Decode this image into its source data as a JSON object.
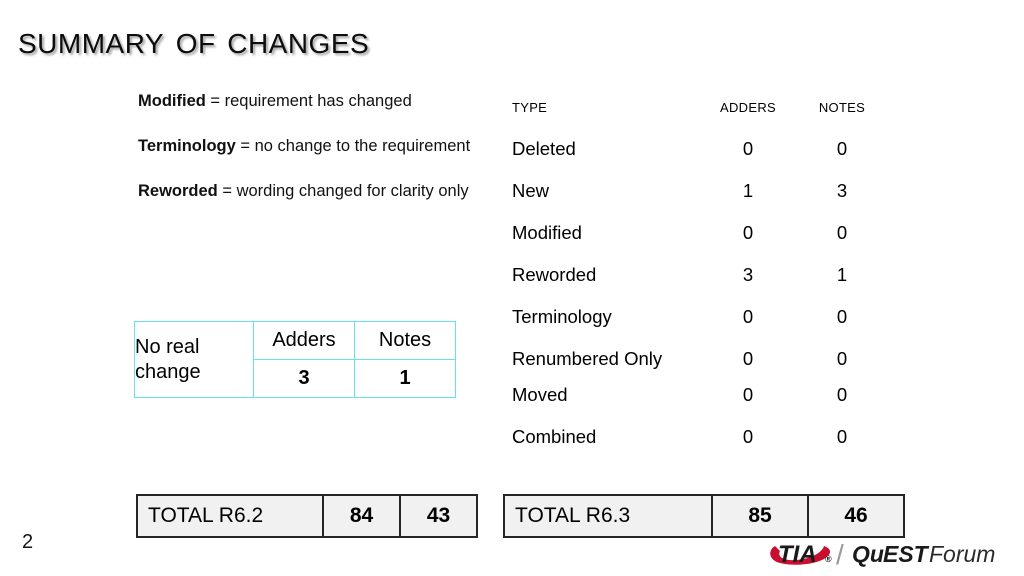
{
  "slide": {
    "title": "Summary of Changes",
    "page_number": "2"
  },
  "definitions": [
    {
      "term": "Modified",
      "rest": " = requirement has changed"
    },
    {
      "term": "Terminology",
      "rest": " = no change to the requirement"
    },
    {
      "term": "Reworded",
      "rest": " = wording changed for clarity only"
    }
  ],
  "no_real_change_table": {
    "label": "No real change",
    "columns": [
      "Adders",
      "Notes"
    ],
    "values": [
      "3",
      "1"
    ],
    "border_color": "#66e2ea"
  },
  "type_table": {
    "headers": {
      "type": "Type",
      "adders": "Adders",
      "notes": "Notes"
    },
    "rows": [
      {
        "type": "Deleted",
        "adders": "0",
        "notes": "0"
      },
      {
        "type": "New",
        "adders": "1",
        "notes": "3"
      },
      {
        "type": "Modified",
        "adders": "0",
        "notes": "0"
      },
      {
        "type": "Reworded",
        "adders": "3",
        "notes": "1"
      },
      {
        "type": "Terminology",
        "adders": "0",
        "notes": "0"
      },
      {
        "type": "Renumbered Only",
        "adders": "0",
        "notes": "0"
      },
      {
        "type": "Moved",
        "adders": "0",
        "notes": "0"
      },
      {
        "type": "Combined",
        "adders": "0",
        "notes": "0"
      }
    ]
  },
  "totals": {
    "left": {
      "label": "TOTAL R6.2",
      "adders": "84",
      "notes": "43"
    },
    "right": {
      "label": "TOTAL R6.3",
      "adders": "85",
      "notes": "46"
    },
    "fill_color": "#f1f1f1",
    "border_color": "#262626"
  },
  "logo": {
    "tia": "TIA",
    "registered": "®",
    "separator": "/",
    "quest_qu": "Qu",
    "quest_est": "EST",
    "forum": "Forum",
    "swoosh_color": "#c8102e",
    "text_color": "#1a1a1a"
  }
}
